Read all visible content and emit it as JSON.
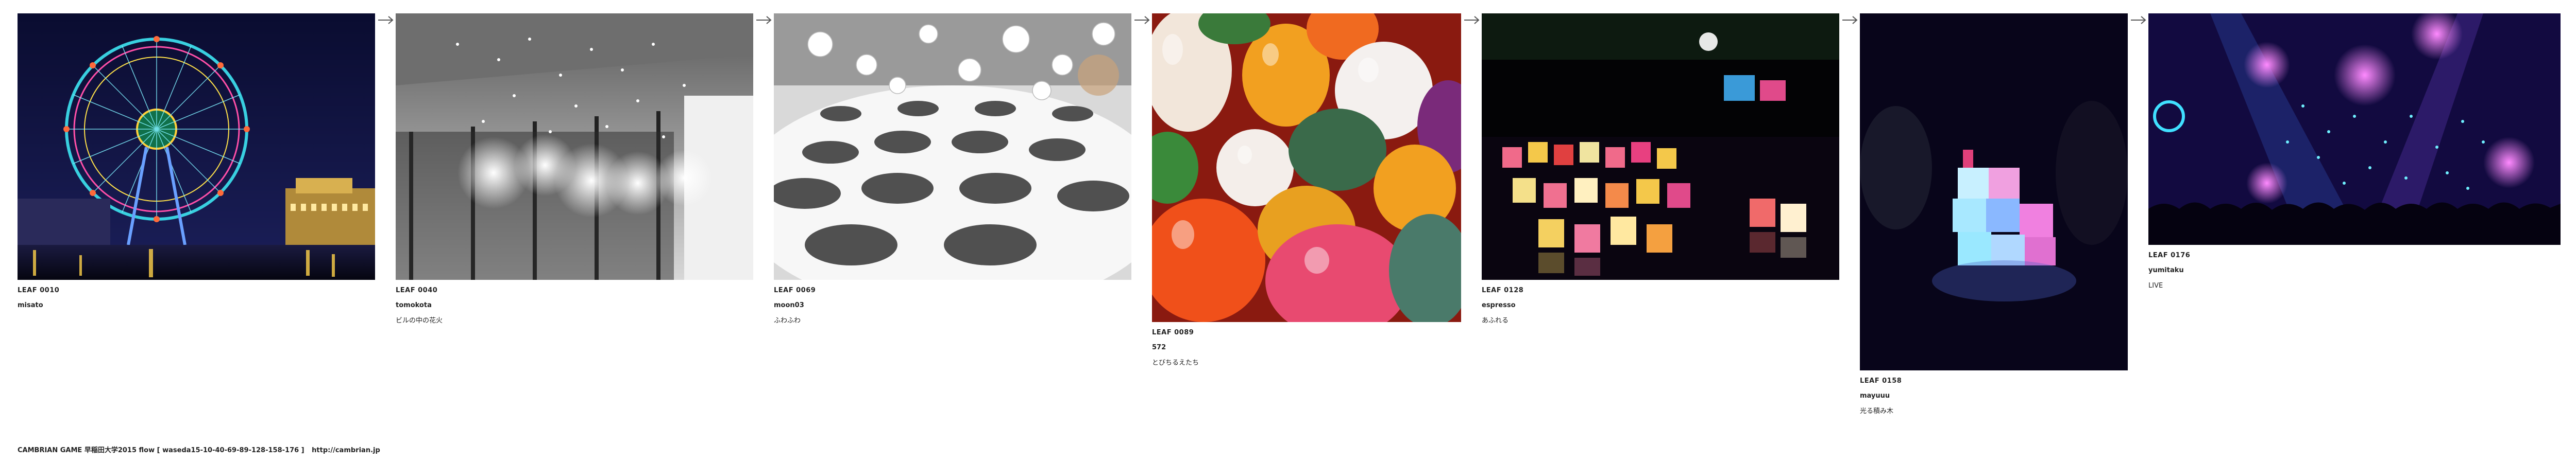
{
  "leaves": [
    {
      "id": "LEAF 0010",
      "user": "misato",
      "title": "",
      "subject": "ferris-wheel-night-photo"
    },
    {
      "id": "LEAF 0040",
      "user": "tomokota",
      "title": "ビルの中の花火",
      "subject": "chandelier-lobby-photo"
    },
    {
      "id": "LEAF 0069",
      "user": "moon03",
      "title": "ふわふわ",
      "subject": "white-spheres-installation-photo"
    },
    {
      "id": "LEAF 0089",
      "user": "572",
      "title": "とびちるえたち",
      "subject": "colorful-balloons-photo"
    },
    {
      "id": "LEAF 0128",
      "user": "espresso",
      "title": "あふれる",
      "subject": "floating-lanterns-photo"
    },
    {
      "id": "LEAF 0158",
      "user": "mayuuu",
      "title": "光る積み木",
      "subject": "glowing-cubes-photo"
    },
    {
      "id": "LEAF 0176",
      "user": "yumitaku",
      "title": "LIVE",
      "subject": "concert-lights-photo"
    }
  ],
  "arrow_icon": "right-arrow-icon",
  "footer": {
    "name": "CAMBRIAN GAME 早稲田大学2015 flow [ waseda15-10-40-69-89-128-158-176 ]",
    "url": "http://cambrian.jp"
  }
}
